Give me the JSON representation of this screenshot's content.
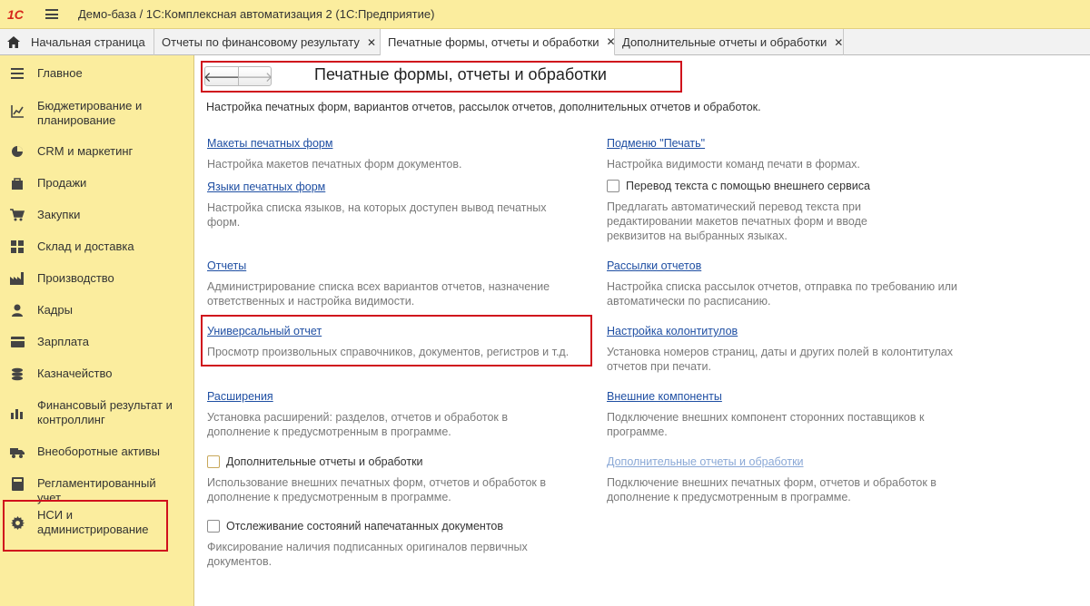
{
  "app": {
    "logo": "1С",
    "title": "Демо-база / 1С:Комплексная автоматизация 2  (1С:Предприятие)"
  },
  "tabs": [
    {
      "label": "Начальная страница",
      "icon": "house-icon"
    },
    {
      "label": "Отчеты по финансовому результату",
      "close": "✕"
    },
    {
      "label": "Печатные формы, отчеты и обработки",
      "close": "✕",
      "active": true
    },
    {
      "label": "Дополнительные отчеты и обработки",
      "close": "✕"
    }
  ],
  "sidebar": {
    "items": [
      {
        "label": "Главное",
        "icon": "menu-lines-icon"
      },
      {
        "label": "Бюджетирование и планирование",
        "icon": "budget-chart-icon"
      },
      {
        "label": "CRM и маркетинг",
        "icon": "pie-chart-icon"
      },
      {
        "label": "Продажи",
        "icon": "shopping-bag-icon"
      },
      {
        "label": "Закупки",
        "icon": "cart-icon"
      },
      {
        "label": "Склад и доставка",
        "icon": "warehouse-grid-icon"
      },
      {
        "label": "Производство",
        "icon": "factory-icon"
      },
      {
        "label": "Кадры",
        "icon": "person-icon"
      },
      {
        "label": "Зарплата",
        "icon": "wallet-icon"
      },
      {
        "label": "Казначейство",
        "icon": "coins-icon"
      },
      {
        "label": "Финансовый результат и контроллинг",
        "icon": "bar-chart-icon"
      },
      {
        "label": "Внеоборотные активы",
        "icon": "truck-icon"
      },
      {
        "label": "Регламентированный учет",
        "icon": "calculator-icon"
      },
      {
        "label": "НСИ и администрирование",
        "icon": "gear-icon"
      }
    ]
  },
  "main": {
    "nav": {
      "back": "🡐",
      "forward": "🡒"
    },
    "title": "Печатные формы, отчеты и обработки",
    "subtitle": "Настройка печатных форм, вариантов отчетов, рассылок отчетов, дополнительных отчетов и обработок.",
    "left": {
      "templates_link": "Макеты печатных форм",
      "templates_desc": "Настройка макетов печатных форм документов.",
      "languages_link": "Языки печатных форм",
      "languages_desc": "Настройка списка языков, на которых доступен вывод печатных форм.",
      "reports_link": "Отчеты",
      "reports_desc": "Администрирование списка всех вариантов отчетов, назначение ответственных и настройка видимости.",
      "universal_link": "Универсальный отчет",
      "universal_desc": "Просмотр произвольных справочников, документов, регистров и т.д.",
      "extensions_link": "Расширения",
      "extensions_desc": "Установка расширений: разделов, отчетов и обработок в дополнение к предусмотренным в программе.",
      "addl_check": "Дополнительные отчеты и обработки",
      "addl_desc": "Использование внешних печатных форм, отчетов и обработок в дополнение к предусмотренным в программе.",
      "tracking_check": "Отслеживание состояний напечатанных документов",
      "tracking_desc": "Фиксирование наличия подписанных оригиналов первичных документов."
    },
    "right": {
      "submenu_link": "Подменю \"Печать\"",
      "submenu_desc": "Настройка видимости команд печати в формах.",
      "translate_check": "Перевод текста с помощью внешнего сервиса",
      "translate_desc": "Предлагать автоматический перевод текста при редактировании макетов печатных форм и вводе реквизитов на выбранных языках.",
      "mailing_link": "Рассылки отчетов",
      "mailing_desc": "Настройка списка рассылок отчетов, отправка по требованию или автоматически по расписанию.",
      "headers_link": "Настройка колонтитулов",
      "headers_desc": "Установка номеров страниц, даты и других полей в колонтитулах отчетов при печати.",
      "external_link": "Внешние компоненты",
      "external_desc": "Подключение внешних компонент сторонних поставщиков к программе.",
      "addl_link": "Дополнительные отчеты и обработки",
      "addl_desc": "Подключение внешних печатных форм, отчетов и обработок в дополнение к предусмотренным в программе."
    }
  },
  "colors": {
    "highlight": "#d0101c",
    "sidebar_bg": "#fbed9e",
    "link": "#1f4fa3"
  }
}
